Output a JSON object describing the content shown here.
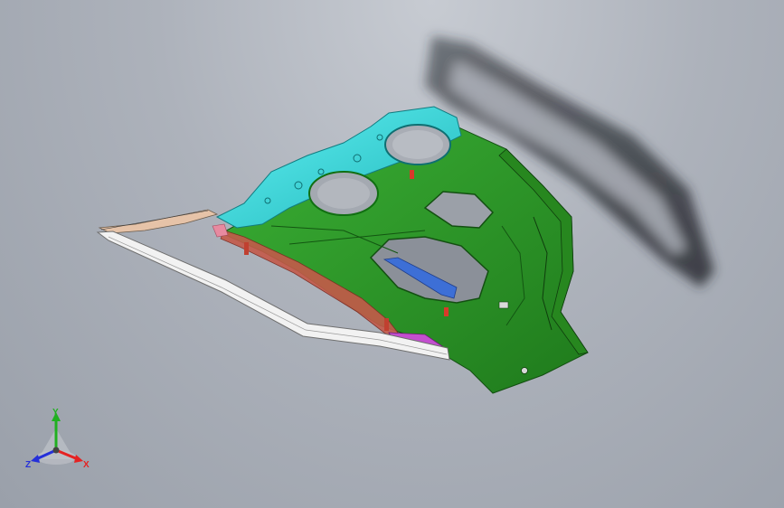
{
  "viewport": {
    "background_top": "#c7cbd2",
    "background_bottom": "#9aa0aa"
  },
  "model": {
    "colors": {
      "outer_panel": "#2f9a2b",
      "outer_panel_dark": "#1d6e1a",
      "upper_panel": "#33e3e6",
      "upper_panel_dark": "#1aa9ad",
      "belt_rail": "#f2f2f2",
      "belt_rail_dark": "#6f6f6f",
      "rear_trim": "#e6c3a8",
      "brace": "#c45a4a",
      "side_bar": "#e78aa0",
      "blue_bar": "#3d6fd6",
      "magenta_plate": "#c34fcf",
      "shadow": "#2a2d33"
    }
  },
  "triad": {
    "labels": {
      "x": "X",
      "y": "Y",
      "z": "Z"
    },
    "colors": {
      "x": "#e52222",
      "y": "#20b020",
      "z": "#2530d9"
    },
    "icon": "coordinate-triad-icon"
  }
}
